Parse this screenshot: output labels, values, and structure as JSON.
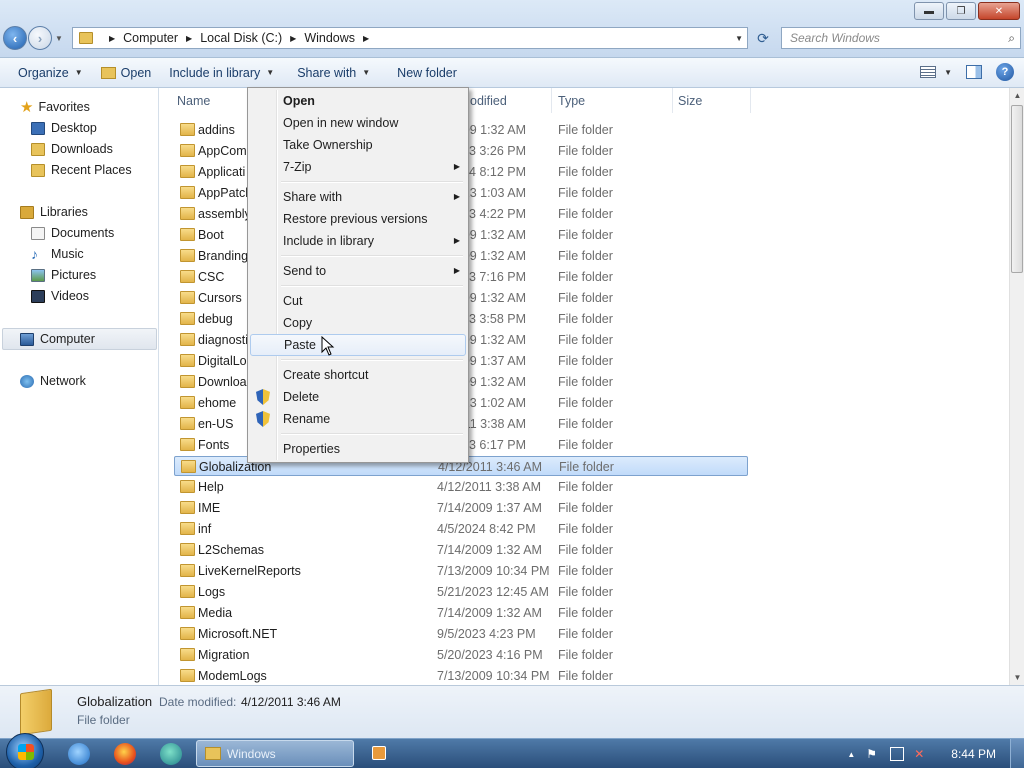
{
  "window": {
    "controls": {
      "minimize": "▬",
      "maximize": "❐",
      "close": "✕"
    }
  },
  "address_bar": {
    "crumbs": [
      "Computer",
      "Local Disk (C:)",
      "Windows"
    ],
    "search_placeholder": "Search Windows"
  },
  "toolbar": {
    "organize": "Organize",
    "open": "Open",
    "include_in_library": "Include in library",
    "share_with": "Share with",
    "new_folder": "New folder"
  },
  "nav_pane": {
    "favorites": "Favorites",
    "favorites_items": [
      "Desktop",
      "Downloads",
      "Recent Places"
    ],
    "libraries": "Libraries",
    "libraries_items": [
      "Documents",
      "Music",
      "Pictures",
      "Videos"
    ],
    "computer": "Computer",
    "network": "Network"
  },
  "file_list": {
    "columns": {
      "name": "Name",
      "date": "Date modified",
      "date_visible": "odified",
      "type": "Type",
      "size": "Size"
    },
    "rows": [
      {
        "name": "addins",
        "date": "7/14/2009 1:32 AM",
        "type": "File folder"
      },
      {
        "name": "AppCompat",
        "date": "5/20/2023 3:26 PM",
        "type": "File folder"
      },
      {
        "name": "Application",
        "date": "4/5/2024 8:12 PM",
        "type": "File folder"
      },
      {
        "name": "AppPatch",
        "date": "5/21/2023 1:03 AM",
        "type": "File folder"
      },
      {
        "name": "assembly",
        "date": "5/2/2023 4:22 PM",
        "type": "File folder"
      },
      {
        "name": "Boot",
        "date": "7/14/2009 1:32 AM",
        "type": "File folder"
      },
      {
        "name": "Branding",
        "date": "7/14/2009 1:32 AM",
        "type": "File folder"
      },
      {
        "name": "CSC",
        "date": "5/20/2023 7:16 PM",
        "type": "File folder"
      },
      {
        "name": "Cursors",
        "date": "7/14/2009 1:32 AM",
        "type": "File folder"
      },
      {
        "name": "debug",
        "date": "5/20/2023 3:58 PM",
        "type": "File folder"
      },
      {
        "name": "diagnostics",
        "date": "7/14/2009 1:32 AM",
        "type": "File folder"
      },
      {
        "name": "DigitalLocker",
        "date": "7/14/2009 1:37 AM",
        "type": "File folder"
      },
      {
        "name": "Downloaded",
        "date": "7/14/2009 1:32 AM",
        "type": "File folder"
      },
      {
        "name": "ehome",
        "date": "5/21/2023 1:02 AM",
        "type": "File folder"
      },
      {
        "name": "en-US",
        "date": "4/12/2011 3:38 AM",
        "type": "File folder"
      },
      {
        "name": "Fonts",
        "date": "5/20/2023 6:17 PM",
        "type": "File folder"
      },
      {
        "name": "Globalization",
        "date": "4/12/2011 3:46 AM",
        "type": "File folder"
      },
      {
        "name": "Help",
        "date": "4/12/2011 3:38 AM",
        "type": "File folder"
      },
      {
        "name": "IME",
        "date": "7/14/2009 1:37 AM",
        "type": "File folder"
      },
      {
        "name": "inf",
        "date": "4/5/2024 8:42 PM",
        "type": "File folder"
      },
      {
        "name": "L2Schemas",
        "date": "7/14/2009 1:32 AM",
        "type": "File folder"
      },
      {
        "name": "LiveKernelReports",
        "date": "7/13/2009 10:34 PM",
        "type": "File folder"
      },
      {
        "name": "Logs",
        "date": "5/21/2023 12:45 AM",
        "type": "File folder"
      },
      {
        "name": "Media",
        "date": "7/14/2009 1:32 AM",
        "type": "File folder"
      },
      {
        "name": "Microsoft.NET",
        "date": "9/5/2023 4:23 PM",
        "type": "File folder"
      },
      {
        "name": "Migration",
        "date": "5/20/2023 4:16 PM",
        "type": "File folder"
      },
      {
        "name": "ModemLogs",
        "date": "7/13/2009 10:34 PM",
        "type": "File folder"
      }
    ],
    "visible_rows": [
      {
        "name": "addins",
        "date": "2009 1:32 AM"
      },
      {
        "name": "AppCom",
        "date": "2023 3:26 PM"
      },
      {
        "name": "Applicati",
        "date": "24 8:12 PM"
      },
      {
        "name": "AppPatch",
        "date": "2023 1:03 AM"
      },
      {
        "name": "assembly",
        "date": "23 4:22 PM"
      },
      {
        "name": "Boot",
        "date": "2009 1:32 AM"
      },
      {
        "name": "Branding",
        "date": "2009 1:32 AM"
      },
      {
        "name": "CSC",
        "date": "2023 7:16 PM"
      },
      {
        "name": "Cursors",
        "date": "2009 1:32 AM"
      },
      {
        "name": "debug",
        "date": "2023 3:58 PM"
      },
      {
        "name": "diagnosti",
        "date": "2009 1:32 AM"
      },
      {
        "name": "DigitalLo",
        "date": "2009 1:37 AM"
      },
      {
        "name": "Downloa",
        "date": "2009 1:32 AM"
      },
      {
        "name": "ehome",
        "date": "2023 1:02 AM"
      },
      {
        "name": "en-US",
        "date": "2011 3:38 AM"
      },
      {
        "name": "Fonts",
        "date": "2023 6:17 PM"
      },
      {
        "name": "Globalization",
        "date": "4/12/2011 3:46 AM"
      },
      {
        "name": "Help",
        "date": "4/12/2011 3:38 AM"
      },
      {
        "name": "IME",
        "date": "7/14/2009 1:37 AM"
      },
      {
        "name": "inf",
        "date": "4/5/2024 8:42 PM"
      },
      {
        "name": "L2Schemas",
        "date": "7/14/2009 1:32 AM"
      },
      {
        "name": "LiveKernelReports",
        "date": "7/13/2009 10:34 PM"
      },
      {
        "name": "Logs",
        "date": "5/21/2023 12:45 AM"
      },
      {
        "name": "Media",
        "date": "7/14/2009 1:32 AM"
      },
      {
        "name": "Microsoft.NET",
        "date": "9/5/2023 4:23 PM"
      },
      {
        "name": "Migration",
        "date": "5/20/2023 4:16 PM"
      },
      {
        "name": "ModemLogs",
        "date": "7/13/2009 10:34 PM"
      }
    ],
    "selected_index": 16
  },
  "context_menu": {
    "items": [
      {
        "label": "Open",
        "bold": true
      },
      {
        "label": "Open in new window"
      },
      {
        "label": "Take Ownership"
      },
      {
        "label": "7-Zip",
        "submenu": true
      },
      {
        "label": "Share with",
        "submenu": true
      },
      {
        "label": "Restore previous versions"
      },
      {
        "label": "Include in library",
        "submenu": true
      },
      {
        "label": "Send to",
        "submenu": true
      },
      {
        "label": "Cut"
      },
      {
        "label": "Copy"
      },
      {
        "label": "Paste",
        "highlighted": true
      },
      {
        "label": "Create shortcut"
      },
      {
        "label": "Delete",
        "shield": true
      },
      {
        "label": "Rename",
        "shield": true
      },
      {
        "label": "Properties"
      }
    ]
  },
  "details_pane": {
    "name": "Globalization",
    "date_label": "Date modified:",
    "date_value": "4/12/2011 3:46 AM",
    "type": "File folder"
  },
  "taskbar": {
    "window_button": "Windows",
    "clock": "8:44 PM"
  },
  "colors": {
    "accent": "#3d6ea8",
    "selection": "#c1dbfa",
    "menu_highlight": "#e6eef9",
    "folder": "#e2b44a"
  }
}
